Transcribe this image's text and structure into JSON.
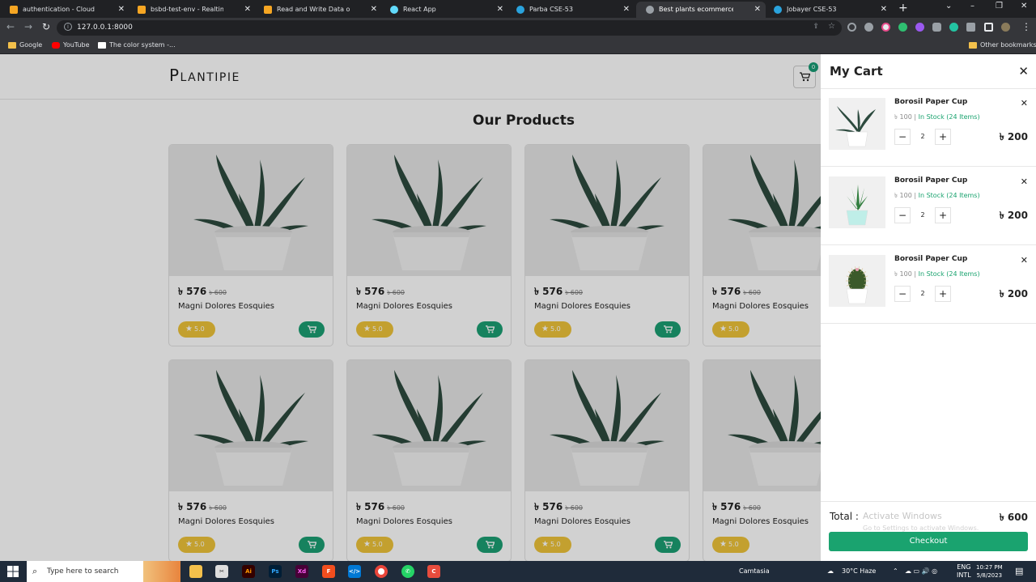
{
  "browser": {
    "tabs": [
      {
        "label": "authentication - Cloud Firestore",
        "icon_color": "#f6a623",
        "active": false
      },
      {
        "label": "bsbd-test-env - Realtime Database",
        "icon_color": "#f6a623",
        "active": false
      },
      {
        "label": "Read and Write Data on the Web",
        "icon_color": "#f6a623",
        "active": false
      },
      {
        "label": "React App",
        "icon_color": "#61dafb",
        "active": false
      },
      {
        "label": "Parba CSE-53",
        "icon_color": "#2aa3dd",
        "active": false
      },
      {
        "label": "Best plants ecommerce platform",
        "icon_color": "#9aa0a6",
        "active": true
      },
      {
        "label": "Jobayer CSE-53",
        "icon_color": "#2aa3dd",
        "active": false
      }
    ],
    "new_tab_label": "+",
    "url": "127.0.0.1:8000",
    "bookmarks": [
      {
        "label": "Google",
        "icon_color": "#f3c04b"
      },
      {
        "label": "YouTube",
        "icon_color": "#ff0000"
      },
      {
        "label": "The color system -...",
        "icon_color": "#ffffff"
      }
    ],
    "other_bookmarks": "Other bookmarks"
  },
  "site": {
    "logo": "Plantipie",
    "cart_count": "0",
    "section_title": "Our Products"
  },
  "products": [
    {
      "price": "৳ 576",
      "old_price": "৳ 600",
      "name": "Magni Dolores Eosquies",
      "rating": "5.0"
    },
    {
      "price": "৳ 576",
      "old_price": "৳ 600",
      "name": "Magni Dolores Eosquies",
      "rating": "5.0"
    },
    {
      "price": "৳ 576",
      "old_price": "৳ 600",
      "name": "Magni Dolores Eosquies",
      "rating": "5.0"
    },
    {
      "price": "৳ 576",
      "old_price": "৳ 600",
      "name": "Magni Dolores Eosquies",
      "rating": "5.0"
    },
    {
      "price": "৳ 576",
      "old_price": "৳ 600",
      "name": "Magni Dolores Eosquies",
      "rating": "5.0"
    },
    {
      "price": "৳ 576",
      "old_price": "৳ 600",
      "name": "Magni Dolores Eosquies",
      "rating": "5.0"
    },
    {
      "price": "৳ 576",
      "old_price": "৳ 600",
      "name": "Magni Dolores Eosquies",
      "rating": "5.0"
    },
    {
      "price": "৳ 576",
      "old_price": "৳ 600",
      "name": "Magni Dolores Eosquies",
      "rating": "5.0"
    }
  ],
  "cart": {
    "title": "My Cart",
    "items": [
      {
        "name": "Borosil Paper Cup",
        "unit_price": "৳ 100",
        "stock": "In Stock (24 Items)",
        "qty": "2",
        "total": "৳ 200",
        "plant": "aloe",
        "pot": "#ffffff"
      },
      {
        "name": "Borosil Paper Cup",
        "unit_price": "৳ 100",
        "stock": "In Stock (24 Items)",
        "qty": "2",
        "total": "৳ 200",
        "plant": "succulent",
        "pot": "#bfeee8"
      },
      {
        "name": "Borosil Paper Cup",
        "unit_price": "৳ 100",
        "stock": "In Stock (24 Items)",
        "qty": "2",
        "total": "৳ 200",
        "plant": "cactus",
        "pot": "#ffffff"
      }
    ],
    "total_label": "Total :",
    "total_value": "৳ 600",
    "checkout_label": "Checkout",
    "watermark_title": "Activate Windows",
    "watermark_sub": "Go to Settings to activate Windows."
  },
  "taskbar": {
    "search_placeholder": "Type here to search",
    "camtasia": "Camtasia",
    "weather": "30°C  Haze",
    "lang1": "ENG",
    "lang2": "INTL",
    "time": "10:27 PM",
    "date": "5/8/2023"
  },
  "colors": {
    "accent_green": "#1aa36f",
    "rating_yellow": "#eec43a"
  }
}
